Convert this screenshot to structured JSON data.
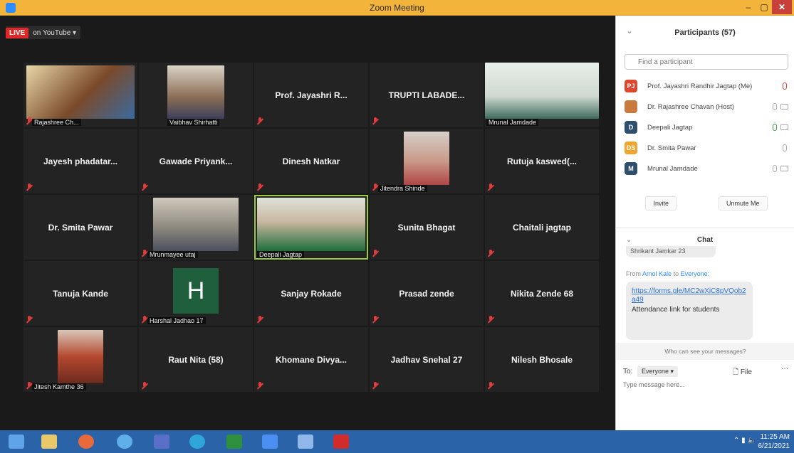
{
  "window": {
    "title": "Zoom Meeting",
    "minimize": "–",
    "maximize": "▢",
    "close": "✕"
  },
  "live": {
    "badge": "LIVE",
    "label": "on YouTube ▾"
  },
  "tiles": [
    {
      "name": "Rajashree Ch..."
    },
    {
      "name": "Vaibhav Shirhatti"
    },
    {
      "name": "Prof. Jayashri R..."
    },
    {
      "name": "TRUPTI LABADE..."
    },
    {
      "name": "Mrunal Jamdade"
    },
    {
      "name": "Jayesh phadatar..."
    },
    {
      "name": "Gawade Priyank..."
    },
    {
      "name": "Dinesh Natkar"
    },
    {
      "name": "Jitendra Shinde"
    },
    {
      "name": "Rutuja kaswed(..."
    },
    {
      "name": "Dr. Smita Pawar"
    },
    {
      "name": "Mrunmayee utaj"
    },
    {
      "name": "Deepali Jagtap"
    },
    {
      "name": "Sunita Bhagat"
    },
    {
      "name": "Chaitali jagtap"
    },
    {
      "name": "Tanuja Kande"
    },
    {
      "name": "Harshal Jadhao 17",
      "letter": "H"
    },
    {
      "name": "Sanjay Rokade"
    },
    {
      "name": "Prasad zende"
    },
    {
      "name": "Nikita Zende 68"
    },
    {
      "name": "Jitesh Kamthe 36"
    },
    {
      "name": "Raut Nita (58)"
    },
    {
      "name": "Khomane Divya..."
    },
    {
      "name": "Jadhav Snehal 27"
    },
    {
      "name": "Nilesh Bhosale"
    }
  ],
  "participants": {
    "title": "Participants (57)",
    "collapse": "⌄",
    "search_placeholder": "Find a participant",
    "list": [
      {
        "initials": "PJ",
        "name": "Prof. Jayashri Randhir Jagtap (Me)",
        "color": "#e0452e"
      },
      {
        "initials": "",
        "name": "Dr. Rajashree Chavan (Host)",
        "color": "#c97a3d"
      },
      {
        "initials": "D",
        "name": "Deepali Jagtap",
        "color": "#2f4f6f"
      },
      {
        "initials": "DS",
        "name": "Dr. Smita Pawar",
        "color": "#f2a42c"
      },
      {
        "initials": "M",
        "name": "Mrunal Jamdade",
        "color": "#2f4f6f"
      }
    ],
    "invite": "Invite",
    "unmute": "Unmute Me"
  },
  "chat": {
    "title": "Chat",
    "collapse": "⌄",
    "prev_message": "Shrikant Jamkar 23",
    "from_prefix": "From",
    "from_name": "Amol Kale",
    "to_text": "to",
    "to_name": "Everyone:",
    "url": "https://forms.gle/MC2wXiC8pVQob2a49",
    "message": "Attendance link for students",
    "who_can_see": "Who can see your messages?",
    "to_label": "To:",
    "to_value": "Everyone ▾",
    "file": "File",
    "more": "···",
    "input_placeholder": "Type message here..."
  },
  "taskbar": {
    "tray": "⌃  ▮  🔈",
    "time": "11:25 AM",
    "date": "6/21/2021"
  }
}
